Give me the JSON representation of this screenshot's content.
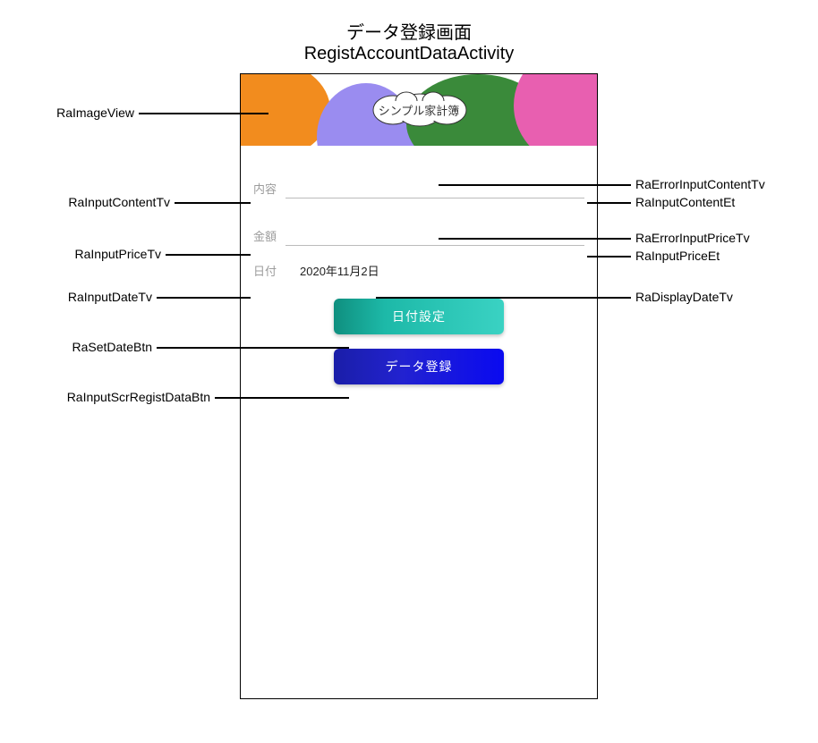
{
  "title": {
    "jp": "データ登録画面",
    "en": "RegistAccountDataActivity"
  },
  "header": {
    "logo_text": "シンプル家計簿"
  },
  "fields": {
    "content": {
      "label": "内容",
      "value": "",
      "error": ""
    },
    "price": {
      "label": "金額",
      "value": "",
      "error": ""
    },
    "date": {
      "label": "日付",
      "display": "2020年11月2日"
    }
  },
  "buttons": {
    "set_date": "日付設定",
    "regist": "データ登録"
  },
  "annotations": {
    "left": {
      "image_view": "RaImageView",
      "content_tv": "RaInputContentTv",
      "price_tv": "RaInputPriceTv",
      "date_tv": "RaInputDateTv",
      "set_date_btn": "RaSetDateBtn",
      "regist_btn": "RaInputScrRegistDataBtn"
    },
    "right": {
      "err_content_tv": "RaErrorInputContentTv",
      "content_et": "RaInputContentEt",
      "err_price_tv": "RaErrorInputPriceTv",
      "price_et": "RaInputPriceEt",
      "display_date_tv": "RaDisplayDateTv"
    }
  },
  "colors": {
    "orange": "#f28c1e",
    "lavender": "#9a8cf0",
    "green": "#3a8a3a",
    "pink": "#e85fb0",
    "teal1": "#1db9a8",
    "blue1": "#1a1ea8"
  }
}
